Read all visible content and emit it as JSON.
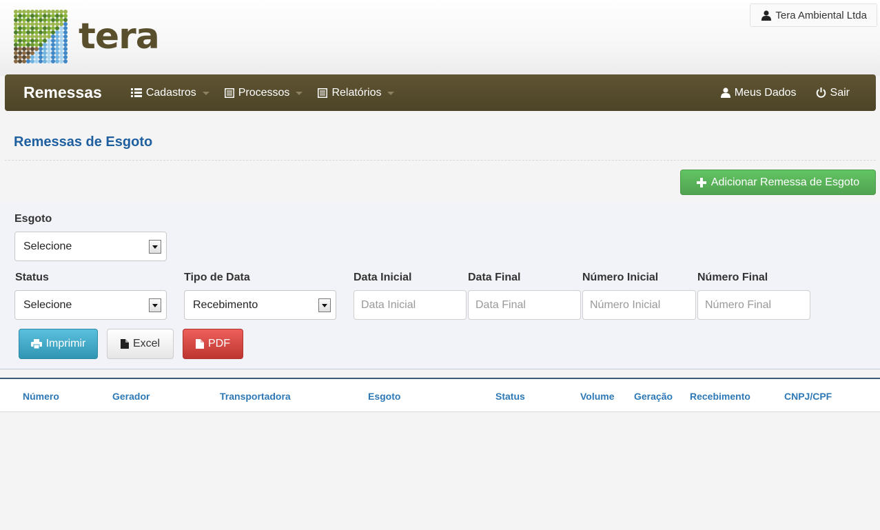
{
  "app": {
    "logo_text": "tera",
    "user_name": "Tera Ambiental Ltda"
  },
  "navbar": {
    "brand": "Remessas",
    "menus": [
      {
        "label": "Cadastros",
        "icon": "list-icon"
      },
      {
        "label": "Processos",
        "icon": "document-icon"
      },
      {
        "label": "Relatórios",
        "icon": "document-icon"
      }
    ],
    "right": [
      {
        "label": "Meus Dados",
        "icon": "user-icon"
      },
      {
        "label": "Sair",
        "icon": "power-icon"
      }
    ]
  },
  "page": {
    "title": "Remessas de Esgoto",
    "add_button": "Adicionar Remessa de Esgoto"
  },
  "filters": {
    "esgoto": {
      "label": "Esgoto",
      "value": "Selecione"
    },
    "status": {
      "label": "Status",
      "value": "Selecione"
    },
    "tipo_data": {
      "label": "Tipo de Data",
      "value": "Recebimento"
    },
    "data_inicial": {
      "label": "Data Inicial",
      "placeholder": "Data Inicial"
    },
    "data_final": {
      "label": "Data Final",
      "placeholder": "Data Final"
    },
    "numero_inicial": {
      "label": "Número Inicial",
      "placeholder": "Número Inicial"
    },
    "numero_final": {
      "label": "Número Final",
      "placeholder": "Número Final"
    }
  },
  "actions": {
    "print": "Imprimir",
    "excel": "Excel",
    "pdf": "PDF"
  },
  "table": {
    "columns": [
      "Número",
      "Gerador",
      "Transportadora",
      "Esgoto",
      "Status",
      "Volume",
      "Geração",
      "Recebimento",
      "CNPJ/CPF"
    ]
  },
  "colors": {
    "navbar": "#554b2e",
    "title": "#1e5fa0",
    "add_button": "#5bb75b",
    "print_button": "#49afcd",
    "pdf_button": "#da4f49",
    "table_header_text": "#2d78b6"
  }
}
